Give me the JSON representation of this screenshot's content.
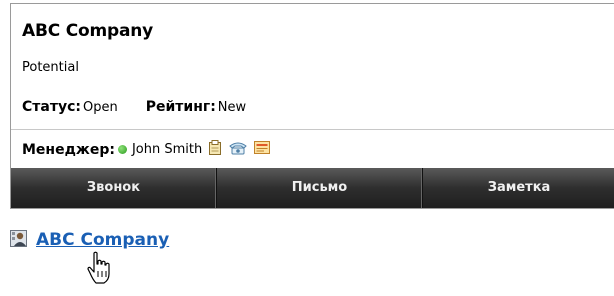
{
  "card": {
    "title": "ABC Company",
    "subtitle": "Potential",
    "status_label": "Статус:",
    "status_value": "Open",
    "rating_label": "Рейтинг:",
    "rating_value": "New",
    "manager_label": "Менеджер:",
    "manager_name": "John Smith",
    "manager_status_color": "#2a9a1e"
  },
  "toolbar": {
    "buttons": [
      {
        "label": "Звонок"
      },
      {
        "label": "Письмо"
      },
      {
        "label": "Заметка"
      }
    ]
  },
  "contact_link": {
    "label": "ABC Company",
    "icon": "contact-card-icon",
    "cursor_icon": "hand-pointer-icon"
  },
  "icons": {
    "clipboard": "clipboard-icon",
    "phone": "phone-icon",
    "card": "business-card-icon"
  }
}
